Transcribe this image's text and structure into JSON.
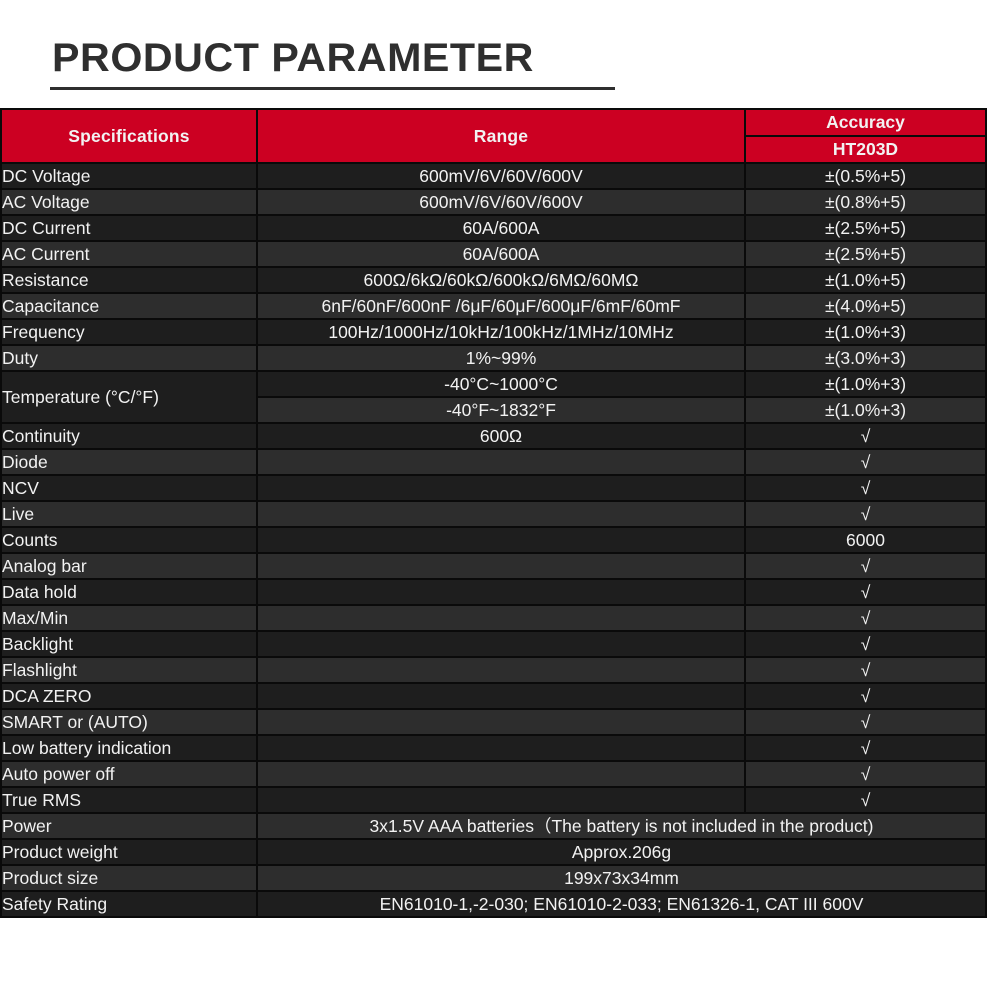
{
  "page": {
    "title": "PRODUCT PARAMETER",
    "accent_red": "#cc0022",
    "row_bg_odd": "#1e1e1e",
    "row_bg_even": "#2d2d2d",
    "check_symbol": "√"
  },
  "table": {
    "headers": {
      "specifications": "Specifications",
      "range": "Range",
      "accuracy": "Accuracy",
      "model": "HT203D"
    },
    "rows": [
      {
        "spec": "DC Voltage",
        "range": "600mV/6V/60V/600V",
        "acc": "±(0.5%+5)"
      },
      {
        "spec": "AC Voltage",
        "range": "600mV/6V/60V/600V",
        "acc": "±(0.8%+5)"
      },
      {
        "spec": "DC Current",
        "range": "60A/600A",
        "acc": "±(2.5%+5)"
      },
      {
        "spec": "AC Current",
        "range": "60A/600A",
        "acc": "±(2.5%+5)"
      },
      {
        "spec": "Resistance",
        "range": "600Ω/6kΩ/60kΩ/600kΩ/6MΩ/60MΩ",
        "acc": "±(1.0%+5)"
      },
      {
        "spec": "Capacitance",
        "range": "6nF/60nF/600nF /6μF/60μF/600μF/6mF/60mF",
        "acc": "±(4.0%+5)"
      },
      {
        "spec": "Frequency",
        "range": "100Hz/1000Hz/10kHz/100kHz/1MHz/10MHz",
        "acc": "±(1.0%+3)"
      },
      {
        "spec": "Duty",
        "range": "1%~99%",
        "acc": "±(3.0%+3)"
      }
    ],
    "temperature": {
      "spec": "Temperature (°C/°F)",
      "sub_rows": [
        {
          "range": "-40°C~1000°C",
          "acc": "±(1.0%+3)"
        },
        {
          "range": "-40°F~1832°F",
          "acc": "±(1.0%+3)"
        }
      ]
    },
    "rows2": [
      {
        "spec": "Continuity",
        "range": "600Ω",
        "acc": "√"
      },
      {
        "spec": "Diode",
        "range": "",
        "acc": "√"
      },
      {
        "spec": "NCV",
        "range": "",
        "acc": "√"
      },
      {
        "spec": "Live",
        "range": "",
        "acc": "√"
      },
      {
        "spec": "Counts",
        "range": "",
        "acc": "6000"
      },
      {
        "spec": "Analog bar",
        "range": "",
        "acc": "√"
      },
      {
        "spec": "Data hold",
        "range": "",
        "acc": "√"
      },
      {
        "spec": "Max/Min",
        "range": "",
        "acc": "√"
      },
      {
        "spec": "Backlight",
        "range": "",
        "acc": "√"
      },
      {
        "spec": "Flashlight",
        "range": "",
        "acc": "√"
      },
      {
        "spec": "DCA ZERO",
        "range": "",
        "acc": "√"
      },
      {
        "spec": "SMART or (AUTO)",
        "range": "",
        "acc": "√"
      },
      {
        "spec": "Low battery indication",
        "range": "",
        "acc": "√"
      },
      {
        "spec": "Auto power off",
        "range": "",
        "acc": "√"
      },
      {
        "spec": "True RMS",
        "range": "",
        "acc": "√"
      }
    ],
    "rows_merged": [
      {
        "spec": "Power",
        "value": "3x1.5V AAA batteries（The battery is not included in the product)"
      },
      {
        "spec": "Product weight",
        "value": "Approx.206g"
      },
      {
        "spec": "Product size",
        "value": "199x73x34mm"
      },
      {
        "spec": "Safety Rating",
        "value": "EN61010-1,-2-030; EN61010-2-033; EN61326-1, CAT III 600V"
      }
    ]
  }
}
